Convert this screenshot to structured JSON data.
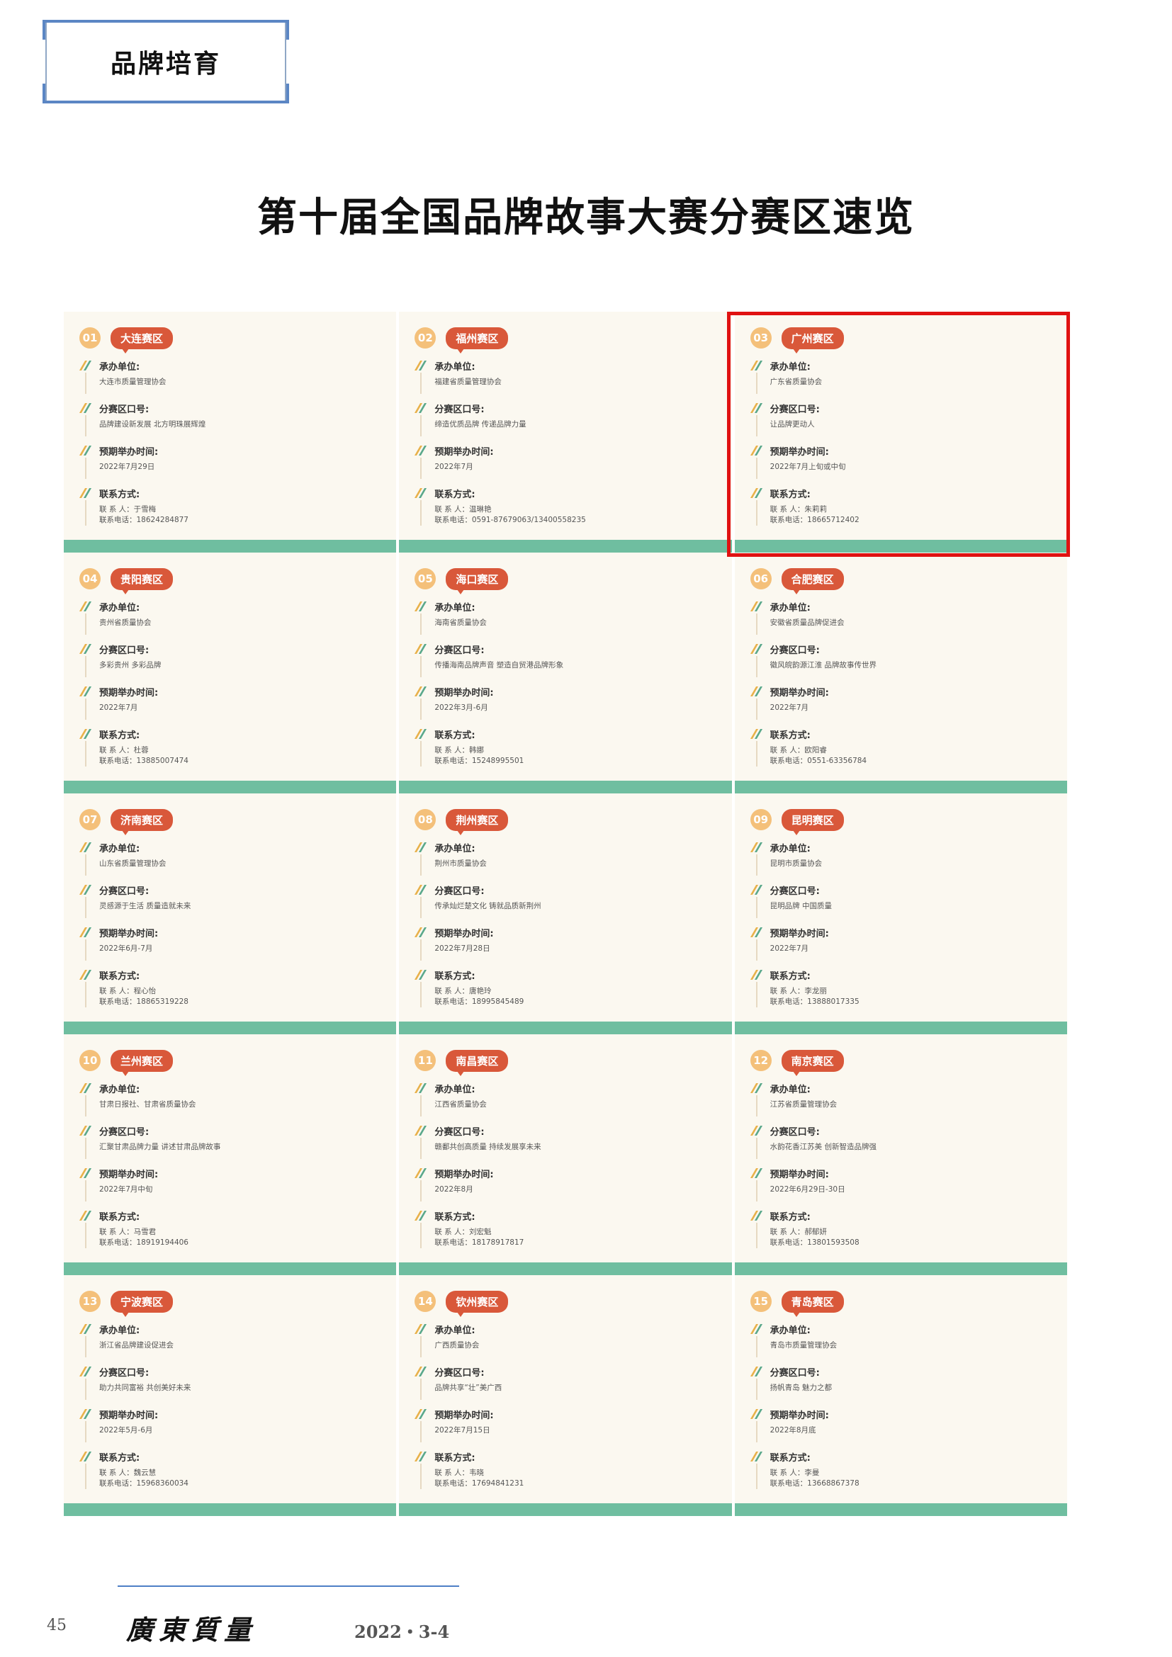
{
  "header": {
    "section_tag": "品牌培育"
  },
  "title": "第十届全国品牌故事大赛分赛区速览",
  "labels": {
    "organizer": "承办单位:",
    "slogan": "分赛区口号:",
    "time": "预期举办时间:",
    "contact": "联系方式:"
  },
  "divisions": [
    {
      "num": "01",
      "name": "大连赛区",
      "organizer": "大连市质量管理协会",
      "slogan": "品牌建设新发展 北方明珠展辉煌",
      "time": "2022年7月29日",
      "contact_person": "联 系 人：于雪梅",
      "contact_phone": "联系电话：18624284877"
    },
    {
      "num": "02",
      "name": "福州赛区",
      "organizer": "福建省质量管理协会",
      "slogan": "缔造优质品牌 传递品牌力量",
      "time": "2022年7月",
      "contact_person": "联 系 人：温琳艳",
      "contact_phone": "联系电话：0591-87679063/13400558235"
    },
    {
      "num": "03",
      "name": "广州赛区",
      "organizer": "广东省质量协会",
      "slogan": "让品牌更动人",
      "time": "2022年7月上旬或中旬",
      "contact_person": "联 系 人：朱莉莉",
      "contact_phone": "联系电话：18665712402"
    },
    {
      "num": "04",
      "name": "贵阳赛区",
      "organizer": "贵州省质量协会",
      "slogan": "多彩贵州 多彩品牌",
      "time": "2022年7月",
      "contact_person": "联 系 人：杜蓉",
      "contact_phone": "联系电话：13885007474"
    },
    {
      "num": "05",
      "name": "海口赛区",
      "organizer": "海南省质量协会",
      "slogan": "传播海南品牌声音 塑造自贸港品牌形象",
      "time": "2022年3月-6月",
      "contact_person": "联 系 人：韩娜",
      "contact_phone": "联系电话：15248995501"
    },
    {
      "num": "06",
      "name": "合肥赛区",
      "organizer": "安徽省质量品牌促进会",
      "slogan": "徽风皖韵源江淮 品牌故事传世界",
      "time": "2022年7月",
      "contact_person": "联 系 人：欧阳睿",
      "contact_phone": "联系电话：0551-63356784"
    },
    {
      "num": "07",
      "name": "济南赛区",
      "organizer": "山东省质量管理协会",
      "slogan": "灵感源于生活 质量造就未来",
      "time": "2022年6月-7月",
      "contact_person": "联 系 人：程心怡",
      "contact_phone": "联系电话：18865319228"
    },
    {
      "num": "08",
      "name": "荆州赛区",
      "organizer": "荆州市质量协会",
      "slogan": "传承灿烂楚文化 铸就品质新荆州",
      "time": "2022年7月28日",
      "contact_person": "联 系 人：唐艳玲",
      "contact_phone": "联系电话：18995845489"
    },
    {
      "num": "09",
      "name": "昆明赛区",
      "organizer": "昆明市质量协会",
      "slogan": "昆明品牌 中国质量",
      "time": "2022年7月",
      "contact_person": "联 系 人：李龙丽",
      "contact_phone": "联系电话：13888017335"
    },
    {
      "num": "10",
      "name": "兰州赛区",
      "organizer": "甘肃日报社、甘肃省质量协会",
      "slogan": "汇聚甘肃品牌力量 讲述甘肃品牌故事",
      "time": "2022年7月中旬",
      "contact_person": "联 系 人：马雪君",
      "contact_phone": "联系电话：18919194406"
    },
    {
      "num": "11",
      "name": "南昌赛区",
      "organizer": "江西省质量协会",
      "slogan": "赣鄱共创高质量 持续发展享未来",
      "time": "2022年8月",
      "contact_person": "联 系 人：刘宏魁",
      "contact_phone": "联系电话：18178917817"
    },
    {
      "num": "12",
      "name": "南京赛区",
      "organizer": "江苏省质量管理协会",
      "slogan": "水韵花香江苏美 创新智造品牌强",
      "time": "2022年6月29日-30日",
      "contact_person": "联 系 人：郝郁妍",
      "contact_phone": "联系电话：13801593508"
    },
    {
      "num": "13",
      "name": "宁波赛区",
      "organizer": "浙江省品牌建设促进会",
      "slogan": "助力共同富裕 共创美好未来",
      "time": "2022年5月-6月",
      "contact_person": "联 系 人：魏云慧",
      "contact_phone": "联系电话：15968360034"
    },
    {
      "num": "14",
      "name": "钦州赛区",
      "organizer": "广西质量协会",
      "slogan": "品牌共享“壮”美广西",
      "time": "2022年7月15日",
      "contact_person": "联 系 人：韦晓",
      "contact_phone": "联系电话：17694841231"
    },
    {
      "num": "15",
      "name": "青岛赛区",
      "organizer": "青岛市质量管理协会",
      "slogan": "扬帆青岛 魅力之都",
      "time": "2022年8月底",
      "contact_person": "联 系 人：李曼",
      "contact_phone": "联系电话：13668867378"
    }
  ],
  "footer": {
    "page_number": "45",
    "magazine": "廣東質量",
    "issue": "2022・3-4"
  }
}
